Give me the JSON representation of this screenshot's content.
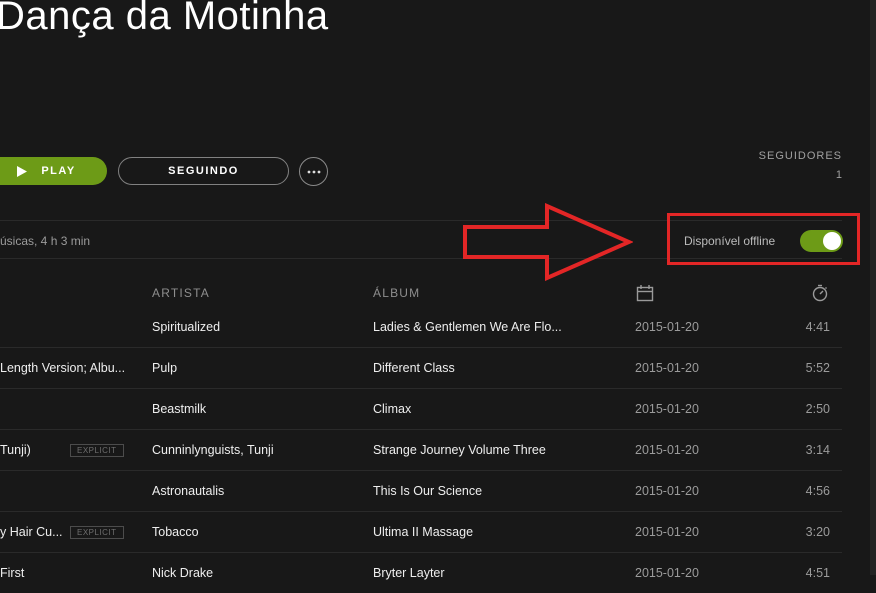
{
  "playlist": {
    "title": "Dança da Motinha",
    "play_label": "PLAY",
    "follow_label": "SEGUINDO",
    "more_label": "•••",
    "followers_label": "SEGUIDORES",
    "followers_count": "1",
    "info": "úsicas, 4 h 3 min",
    "offline_label": "Disponível offline",
    "offline_enabled": true
  },
  "colors": {
    "accent": "#6d9b17",
    "annotation": "#e32626",
    "background": "#181818"
  },
  "columns": {
    "artist": "ARTISTA",
    "album": "ÁLBUM",
    "date_icon": "calendar-icon",
    "duration_icon": "stopwatch-icon"
  },
  "tracks": [
    {
      "title": "",
      "explicit": "",
      "artist": "Spiritualized",
      "album": "Ladies & Gentlemen We Are Flo...",
      "date": "2015-01-20",
      "duration": "4:41"
    },
    {
      "title": "Length Version; Albu...",
      "explicit": "",
      "artist": "Pulp",
      "album": "Different Class",
      "date": "2015-01-20",
      "duration": "5:52"
    },
    {
      "title": "",
      "explicit": "",
      "artist": "Beastmilk",
      "album": "Climax",
      "date": "2015-01-20",
      "duration": "2:50"
    },
    {
      "title": "Tunji)",
      "explicit": "EXPLICIT",
      "artist": "Cunninlynguists, Tunji",
      "album": "Strange Journey Volume Three",
      "date": "2015-01-20",
      "duration": "3:14"
    },
    {
      "title": "",
      "explicit": "",
      "artist": "Astronautalis",
      "album": "This Is Our Science",
      "date": "2015-01-20",
      "duration": "4:56"
    },
    {
      "title": "y Hair Cu...",
      "explicit": "EXPLICIT",
      "artist": "Tobacco",
      "album": "Ultima II Massage",
      "date": "2015-01-20",
      "duration": "3:20"
    },
    {
      "title": "First",
      "explicit": "",
      "artist": "Nick Drake",
      "album": "Bryter Layter",
      "date": "2015-01-20",
      "duration": "4:51"
    }
  ]
}
